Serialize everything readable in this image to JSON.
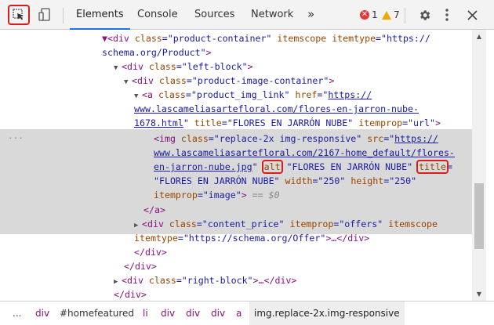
{
  "toolbar": {
    "tabs": [
      "Elements",
      "Console",
      "Sources",
      "Network"
    ],
    "more_tabs": "»",
    "errors": "1",
    "warnings": "7"
  },
  "tree": {
    "l1": {
      "tag_open": "▼<div ",
      "a1n": "class",
      "a1v": "\"product-container\"",
      "a2n": "itemscope",
      "a3n": "itemtype",
      "a3v": "\"https://"
    },
    "l2": {
      "cont": "schema.org/Product\"",
      "close": ">"
    },
    "l3": {
      "tag_open": "<div ",
      "a1n": "class",
      "a1v": "\"left-block\"",
      "close": ">"
    },
    "l4": {
      "tag_open": "<div ",
      "a1n": "class",
      "a1v": "\"product-image-container\"",
      "close": ">"
    },
    "l5": {
      "tag_open": "<a ",
      "a1n": "class",
      "a1v": "\"product_img_link\"",
      "a2n": "href",
      "a2v_link": "https://"
    },
    "l6": {
      "link": "www.lascameliasartefloral.com/flores-en-jarron-nube-"
    },
    "l7": {
      "link": "1678.html",
      "a3n": "title",
      "a3v": "\"FLORES EN JARRÓN NUBE\"",
      "a4n": "itemprop",
      "a4v": "\"url\"",
      "close": ">"
    },
    "l8": {
      "tag_open": "<img ",
      "a1n": "class",
      "a1v": "\"replace-2x img-responsive\"",
      "a2n": "src",
      "a2v_link": "https://"
    },
    "l9": {
      "link": "www.lascameliasartefloral.com/2167-home_default/flores-"
    },
    "l10": {
      "link": "en-jarron-nube.jpg",
      "alt_n": "alt",
      "alt_v": "\"FLORES EN JARRÓN NUBE\"",
      "title_n": "title"
    },
    "l11": {
      "title_v": "\"FLORES EN JARRÓN NUBE\"",
      "w_n": "width",
      "w_v": "\"250\"",
      "h_n": "height",
      "h_v": "\"250\""
    },
    "l12": {
      "ip_n": "itemprop",
      "ip_v": "\"image\"",
      "close": ">",
      "sel": "== $0"
    },
    "l13": {
      "close_tag": "</a>"
    },
    "l14": {
      "tag_open": "<div ",
      "a1n": "class",
      "a1v": "\"content_price\"",
      "a2n": "itemprop",
      "a2v": "\"offers\"",
      "a3n": "itemscope"
    },
    "l15": {
      "a4n": "itemtype",
      "a4v": "\"https://schema.org/Offer\"",
      "rest": ">…</div>"
    },
    "l16": {
      "close_tag": "</div>"
    },
    "l17": {
      "close_tag": "</div>"
    },
    "l18": {
      "tag_open": "<div ",
      "a1n": "class",
      "a1v": "\"right-block\"",
      "rest": ">…</div>"
    },
    "l19": {
      "close_tag": "</div>"
    },
    "dots": "..."
  },
  "breadcrumbs": [
    "...",
    "div",
    "#homefeatured",
    "li",
    "div",
    "div",
    "div",
    "a",
    "img.replace-2x.img-responsive"
  ],
  "colors": {
    "highlight_box": "#d81d1d",
    "tab_underline": "#1a73e8",
    "tag": "#881280",
    "attr_name": "#994500",
    "attr_value": "#1a1aa6"
  }
}
